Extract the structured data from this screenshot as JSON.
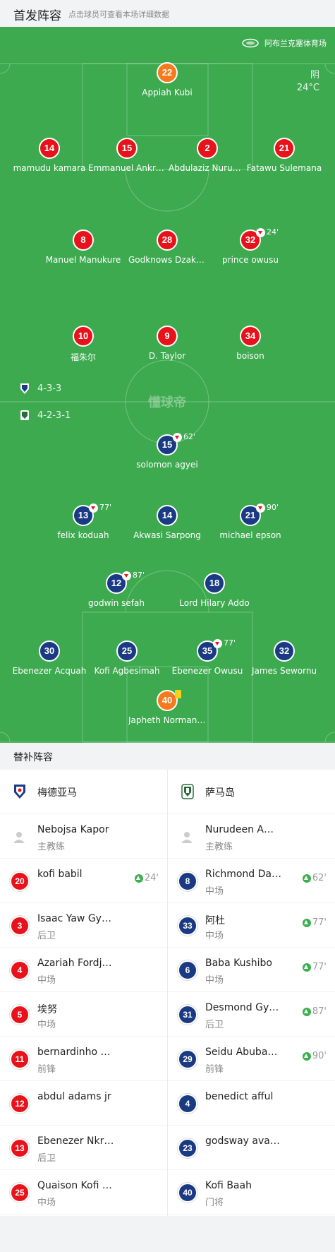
{
  "header": {
    "title": "首发阵容",
    "subtitle": "点击球员可查看本场详细数据"
  },
  "match": {
    "venue": "阿布兰克塞体育场",
    "weather": "阴",
    "temperature": "24°C",
    "center_logo_text": "懂球帝"
  },
  "home": {
    "name": "梅德亚马",
    "formation": "4-3-3",
    "color": "#e8121b",
    "players": [
      {
        "num": "22",
        "name": "Appiah Kubi",
        "keeper": true
      },
      {
        "num": "14",
        "name": "mamudu kamara"
      },
      {
        "num": "15",
        "name": "Emmanuel Ankrah"
      },
      {
        "num": "2",
        "name": "Abdulaziz Nurudeen"
      },
      {
        "num": "21",
        "name": "Fatawu Sulemana"
      },
      {
        "num": "8",
        "name": "Manuel Manukure"
      },
      {
        "num": "28",
        "name": "Godknows Dzakpasu"
      },
      {
        "num": "32",
        "name": "prince owusu",
        "sub_out": "24'"
      },
      {
        "num": "10",
        "name": "福朱尔"
      },
      {
        "num": "9",
        "name": "D. Taylor"
      },
      {
        "num": "34",
        "name": "boison"
      }
    ]
  },
  "away": {
    "name": "萨马岛",
    "formation": "4-2-3-1",
    "color": "#1a3a84",
    "players": [
      {
        "num": "15",
        "name": "solomon agyei",
        "sub_out": "62'"
      },
      {
        "num": "13",
        "name": "felix koduah",
        "sub_out": "77'"
      },
      {
        "num": "14",
        "name": "Akwasi Sarpong"
      },
      {
        "num": "21",
        "name": "michael epson",
        "sub_out": "90'"
      },
      {
        "num": "12",
        "name": "godwin sefah",
        "sub_out": "87'"
      },
      {
        "num": "18",
        "name": "Lord Hilary Addo"
      },
      {
        "num": "30",
        "name": "Ebenezer Acquah"
      },
      {
        "num": "25",
        "name": "Kofi Agbesimah"
      },
      {
        "num": "35",
        "name": "Ebenezer Owusu",
        "sub_out": "77'"
      },
      {
        "num": "32",
        "name": "James Sewornu"
      },
      {
        "num": "40",
        "name": "Japheth Normanyo",
        "keeper": true,
        "card": "yellow"
      }
    ]
  },
  "bench": {
    "title": "替补阵容",
    "home": [
      {
        "type": "coach",
        "name": "Nebojsa Kapor",
        "pos": "主教练"
      },
      {
        "num": "20",
        "name": "kofi babil",
        "pos": "",
        "sub_in": "24'"
      },
      {
        "num": "3",
        "name": "Isaac Yaw Gyamfi",
        "pos": "后卫"
      },
      {
        "num": "4",
        "name": "Azariah Fordjour",
        "pos": "中场"
      },
      {
        "num": "5",
        "name": "埃努",
        "pos": "中场"
      },
      {
        "num": "11",
        "name": "bernardinho ofori",
        "pos": "前锋"
      },
      {
        "num": "12",
        "name": "abdul adams jr",
        "pos": ""
      },
      {
        "num": "13",
        "name": "Ebenezer Nkrumah",
        "pos": "后卫"
      },
      {
        "num": "25",
        "name": "Quaison Kofi Mensah",
        "pos": "中场"
      }
    ],
    "away": [
      {
        "type": "coach",
        "name": "Nurudeen Amadu",
        "pos": "主教练"
      },
      {
        "num": "8",
        "name": "Richmond Darko",
        "pos": "中场",
        "sub_in": "62'"
      },
      {
        "num": "33",
        "name": "阿杜",
        "pos": "中场",
        "sub_in": "77'"
      },
      {
        "num": "6",
        "name": "Baba Kushibo",
        "pos": "中场",
        "sub_in": "77'"
      },
      {
        "num": "31",
        "name": "Desmond Gyamfi",
        "pos": "后卫",
        "sub_in": "87'"
      },
      {
        "num": "29",
        "name": "Seidu Abubakar",
        "pos": "前锋",
        "sub_in": "90'"
      },
      {
        "num": "4",
        "name": "benedict afful",
        "pos": ""
      },
      {
        "num": "23",
        "name": "godsway avadzi",
        "pos": ""
      },
      {
        "num": "40",
        "name": "Kofi Baah",
        "pos": "门将"
      }
    ]
  }
}
